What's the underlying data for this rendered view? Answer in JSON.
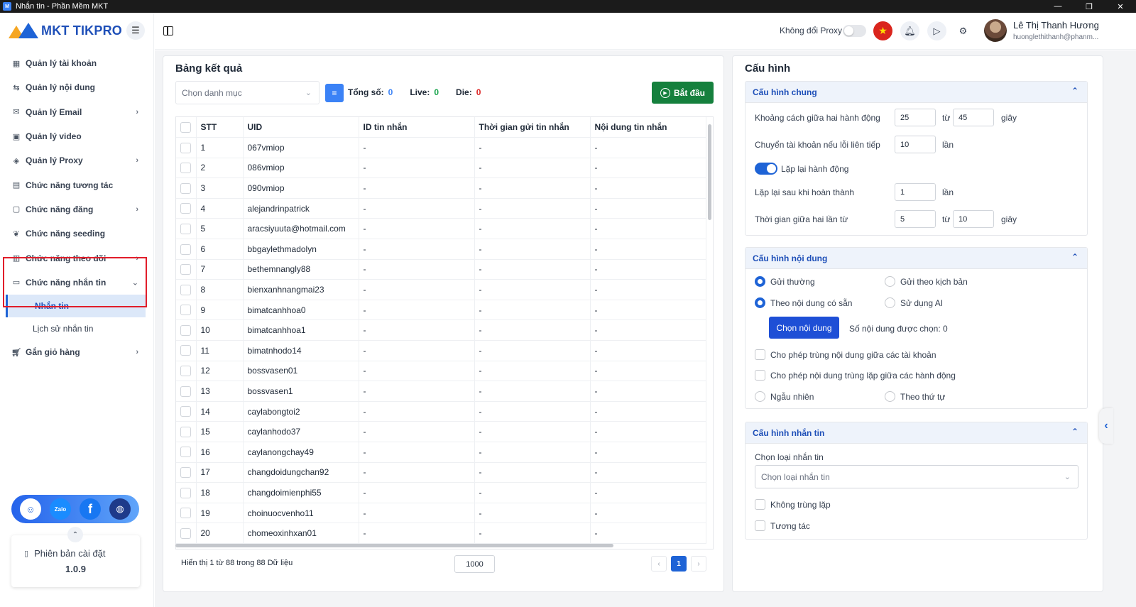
{
  "window": {
    "title": "Nhắn tin - Phần Mềm MKT",
    "controls": [
      "—",
      "❐",
      "✕"
    ]
  },
  "brand": {
    "logo_text": "MKT TIKPRO"
  },
  "sidebar": {
    "items": [
      {
        "label": "Quản lý tài khoản",
        "icon": "dashboard-icon",
        "has_sub": false
      },
      {
        "label": "Quản lý nội dung",
        "icon": "content-icon",
        "has_sub": false
      },
      {
        "label": "Quản lý Email",
        "icon": "email-icon",
        "has_sub": true
      },
      {
        "label": "Quản lý video",
        "icon": "video-icon",
        "has_sub": false
      },
      {
        "label": "Quản lý Proxy",
        "icon": "proxy-icon",
        "has_sub": true
      },
      {
        "label": "Chức năng tương tác",
        "icon": "interact-icon",
        "has_sub": false
      },
      {
        "label": "Chức năng đăng",
        "icon": "post-icon",
        "has_sub": true
      },
      {
        "label": "Chức năng seeding",
        "icon": "seeding-icon",
        "has_sub": false
      },
      {
        "label": "Chức năng theo dõi",
        "icon": "follow-icon",
        "has_sub": true
      }
    ],
    "messaging": {
      "label": "Chức năng nhắn tin",
      "sub_items": [
        "Nhắn tin",
        "Lịch sử nhắn tin"
      ]
    },
    "last_item": {
      "label": "Gắn giỏ hàng",
      "icon": "cart-icon"
    },
    "social": {
      "zalo": "Zalo",
      "facebook": "f"
    },
    "version": {
      "label": "Phiên bản cài đặt",
      "number": "1.0.9"
    }
  },
  "header": {
    "proxy_label": "Không đổi Proxy",
    "user_name": "Lê Thị Thanh Hương",
    "user_email": "huonglethithanh@phanm..."
  },
  "results": {
    "title": "Bảng kết quả",
    "category_placeholder": "Chọn danh mục",
    "total_label": "Tổng số:",
    "total_value": "0",
    "live_label": "Live:",
    "live_value": "0",
    "die_label": "Die:",
    "die_value": "0",
    "start_label": "Bắt đầu",
    "columns": [
      "STT",
      "UID",
      "ID tin nhắn",
      "Thời gian gửi tin nhắn",
      "Nội dung tin nhắn"
    ],
    "rows": [
      [
        "1",
        "067vmiop",
        "-",
        "-",
        "-"
      ],
      [
        "2",
        "086vmiop",
        "-",
        "-",
        "-"
      ],
      [
        "3",
        "090vmiop",
        "-",
        "-",
        "-"
      ],
      [
        "4",
        "alejandrinpatrick",
        "-",
        "-",
        "-"
      ],
      [
        "5",
        "aracsiyuuta@hotmail.com",
        "-",
        "-",
        "-"
      ],
      [
        "6",
        "bbgaylethmadolyn",
        "-",
        "-",
        "-"
      ],
      [
        "7",
        "bethemnangly88",
        "-",
        "-",
        "-"
      ],
      [
        "8",
        "bienxanhnangmai23",
        "-",
        "-",
        "-"
      ],
      [
        "9",
        "bimatcanhhoa0",
        "-",
        "-",
        "-"
      ],
      [
        "10",
        "bimatcanhhoa1",
        "-",
        "-",
        "-"
      ],
      [
        "11",
        "bimatnhodo14",
        "-",
        "-",
        "-"
      ],
      [
        "12",
        "bossvasen01",
        "-",
        "-",
        "-"
      ],
      [
        "13",
        "bossvasen1",
        "-",
        "-",
        "-"
      ],
      [
        "14",
        "caylabongtoi2",
        "-",
        "-",
        "-"
      ],
      [
        "15",
        "caylanhodo37",
        "-",
        "-",
        "-"
      ],
      [
        "16",
        "caylanongchay49",
        "-",
        "-",
        "-"
      ],
      [
        "17",
        "changdoidungchan92",
        "-",
        "-",
        "-"
      ],
      [
        "18",
        "changdoimienphi55",
        "-",
        "-",
        "-"
      ],
      [
        "19",
        "choinuocvenho11",
        "-",
        "-",
        "-"
      ],
      [
        "20",
        "chomeoxinhxan01",
        "-",
        "-",
        "-"
      ]
    ],
    "footer_info": "Hiển thị 1 từ 88 trong 88 Dữ liệu",
    "page_size": "1000",
    "current_page": "1"
  },
  "config": {
    "title": "Cấu hình",
    "general": {
      "title": "Cấu hình chung",
      "delay_label": "Khoảng cách giữa hai hành động",
      "delay_from": "25",
      "delay_to": "45",
      "switch_label": "Chuyển tài khoản nếu lỗi liên tiếp",
      "switch_value": "10",
      "repeat_label": "Lặp lại hành động",
      "repeat_after_label": "Lặp lại sau khi hoàn thành",
      "repeat_after_value": "1",
      "between_label": "Thời gian giữa hai lần từ",
      "between_from": "5",
      "between_to": "10",
      "word_from": "từ",
      "word_sec": "giây",
      "word_times": "lần"
    },
    "content": {
      "title": "Cấu hình nội dung",
      "opt_normal": "Gửi thường",
      "opt_script": "Gửi theo kịch bản",
      "opt_preset": "Theo nội dung có sẵn",
      "opt_ai": "Sử dụng AI",
      "choose_btn": "Chọn nội dung",
      "selected_count": "Số nội dung được chọn: 0",
      "allow_dup_accounts": "Cho phép trùng nội dung giữa các tài khoản",
      "allow_dup_actions": "Cho phép nội dung trùng lặp giữa các hành động",
      "opt_random": "Ngẫu nhiên",
      "opt_order": "Theo thứ tự"
    },
    "messaging": {
      "title": "Cấu hình nhắn tin",
      "type_label": "Chọn loại nhắn tin",
      "type_placeholder": "Chọn loại nhắn tin",
      "no_duplicate": "Không trùng lặp",
      "interact": "Tương tác"
    }
  }
}
